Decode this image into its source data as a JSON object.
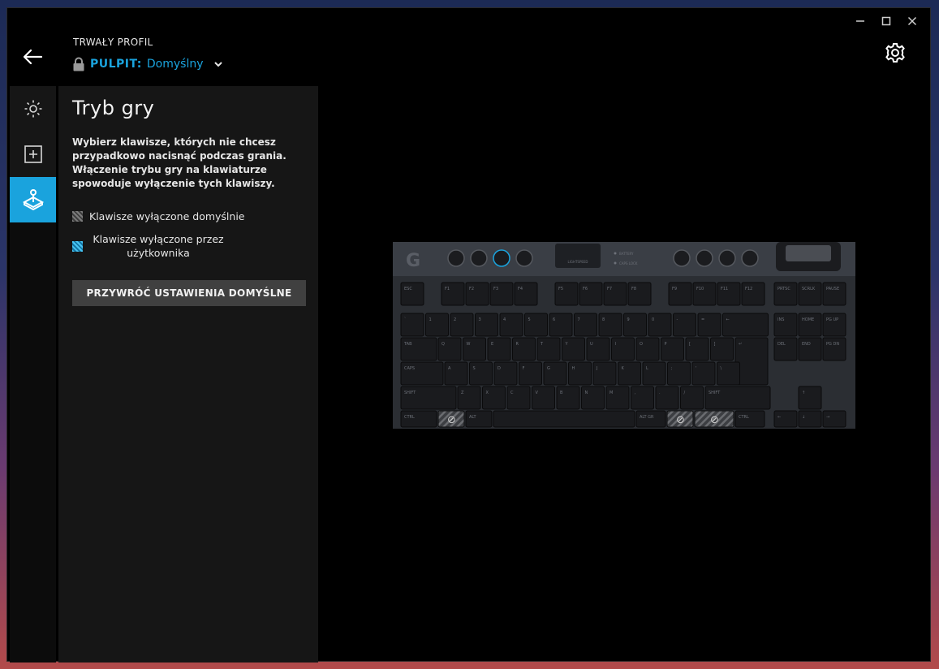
{
  "header": {
    "profile_label": "TRWAŁY PROFIL",
    "profile_prefix": "PULPIT:",
    "profile_name": "Domyślny"
  },
  "icons": {
    "back": "arrow-left-icon",
    "lock": "lock-icon",
    "chevron": "chevron-down-icon",
    "settings": "gear-icon",
    "minimize": "minimize-icon",
    "maximize": "maximize-icon",
    "close": "close-icon"
  },
  "sidebar": {
    "items": [
      {
        "name": "lighting",
        "icon": "sun-icon",
        "active": false
      },
      {
        "name": "assignments",
        "icon": "plus-square-icon",
        "active": false
      },
      {
        "name": "game-mode",
        "icon": "joystick-icon",
        "active": true
      }
    ]
  },
  "panel": {
    "title": "Tryb gry",
    "description": "Wybierz klawisze, których nie chcesz przypadkowo nacisnąć podczas grania. Włączenie trybu gry na klawiaturze spowoduje wyłączenie tych klawiszy.",
    "legend_default": "Klawisze wyłączone domyślnie",
    "legend_user": "Klawisze wyłączone przez użytkownika",
    "restore_button": "PRZYWRÓĆ USTAWIENIA DOMYŚLNE"
  },
  "colors": {
    "accent": "#1aa3dd",
    "panel_bg": "#161616",
    "button_bg": "#404040",
    "window_bg": "#000000"
  },
  "keyboard": {
    "rows": [
      [
        "ESC",
        "F1",
        "F2",
        "F3",
        "F4",
        "F5",
        "F6",
        "F7",
        "F8",
        "F9",
        "F10",
        "F11",
        "F12",
        "PRTSC",
        "SCRLK",
        "PAUSE"
      ],
      [
        "`",
        "1",
        "2",
        "3",
        "4",
        "5",
        "6",
        "7",
        "8",
        "9",
        "0",
        "-",
        "=",
        "←",
        "INS",
        "HOME",
        "PG UP"
      ],
      [
        "TAB",
        "Q",
        "W",
        "E",
        "R",
        "T",
        "Y",
        "U",
        "I",
        "O",
        "P",
        "[",
        "]",
        "↵",
        "DEL",
        "END",
        "PG DN"
      ],
      [
        "CAPS",
        "A",
        "S",
        "D",
        "F",
        "G",
        "H",
        "J",
        "K",
        "L",
        ";",
        "'",
        "\\"
      ],
      [
        "SHIFT",
        "Z",
        "X",
        "C",
        "V",
        "B",
        "N",
        "M",
        ",",
        ".",
        "/",
        "SHIFT",
        "↑"
      ],
      [
        "CTRL",
        "⊘",
        "ALT",
        "",
        "ALT GR",
        "⊘",
        "⊘",
        "CTRL",
        "←",
        "↓",
        "→"
      ]
    ],
    "indicators": [
      "BATTERY",
      "CAPS LOCK"
    ],
    "brand_label": "LIGHTSPEED"
  }
}
